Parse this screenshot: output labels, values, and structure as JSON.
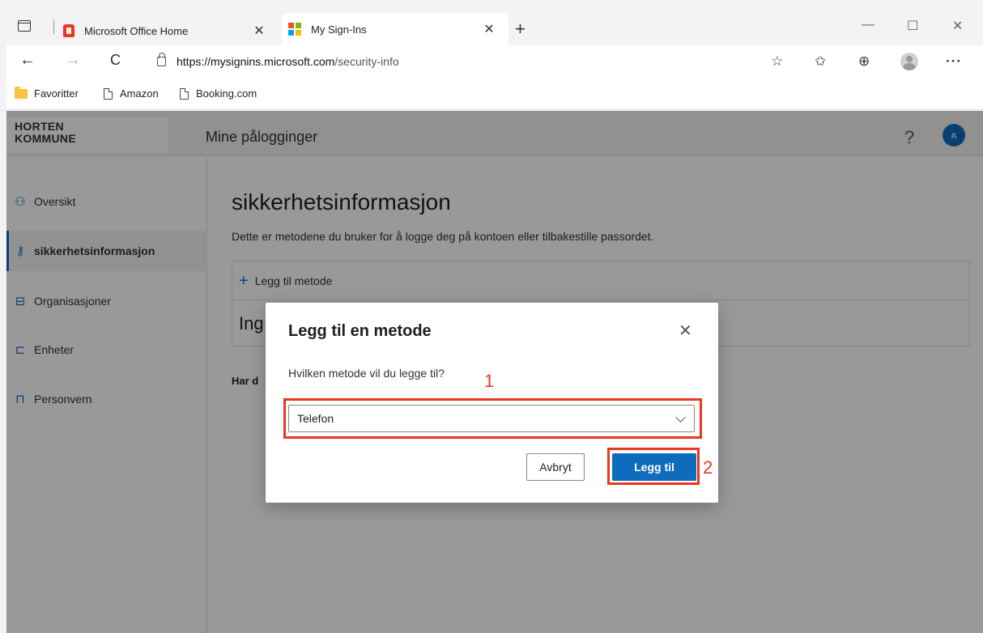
{
  "browser": {
    "tabs": [
      {
        "title": "Microsoft Office Home",
        "close": "✕"
      },
      {
        "title": "My Sign-Ins",
        "close": "✕"
      }
    ],
    "new_tab": "+",
    "window_controls": {
      "minimize": "—",
      "maximize": "☐",
      "close": "✕"
    },
    "nav": {
      "back": "←",
      "forward": "→",
      "refresh": "C"
    },
    "url_host": "https://mysignins.microsoft.com",
    "url_path": "/security-info",
    "toolbar_icons": [
      "favorite-star-icon",
      "favorites-list-icon",
      "collections-icon",
      "profile-icon",
      "more-icon"
    ],
    "more": "···",
    "bookmarks": [
      {
        "label": "Favoritter",
        "icon": "folder-icon"
      },
      {
        "label": "Amazon",
        "icon": "page-icon"
      },
      {
        "label": "Booking.com",
        "icon": "page-icon"
      }
    ]
  },
  "app": {
    "org_line1": "HORTEN",
    "org_line2": "KOMMUNE",
    "title": "Mine pålogginger",
    "help": "?",
    "avatar": "ጸ",
    "accent": "#0f6cbd"
  },
  "sidebar": {
    "items": [
      {
        "label": "Oversikt",
        "icon": "person-icon",
        "glyph": "⚇"
      },
      {
        "label": "sikkerhetsinformasjon",
        "icon": "security-info-icon",
        "glyph": "⚷"
      },
      {
        "label": "Organisasjoner",
        "icon": "briefcase-icon",
        "glyph": "⊟"
      },
      {
        "label": "Enheter",
        "icon": "laptop-icon",
        "glyph": "⊏"
      },
      {
        "label": "Personvern",
        "icon": "lock-icon",
        "glyph": "⊓"
      }
    ],
    "active_index": 1
  },
  "main": {
    "title": "sikkerhetsinformasjon",
    "description": "Dette er metodene du bruker for å logge deg på kontoen eller tilbakestille passordet.",
    "add_method": "Legg til metode",
    "add_plus": "+",
    "no_items": "Ing",
    "lost_device": "Har d"
  },
  "dialog": {
    "title": "Legg til en metode",
    "close": "✕",
    "question": "Hvilken metode vil du legge til?",
    "selected_option": "Telefon",
    "cancel_label": "Avbryt",
    "confirm_label": "Legg til"
  },
  "annotations": {
    "step1": "1",
    "step2": "2",
    "color": "#e8381f"
  }
}
